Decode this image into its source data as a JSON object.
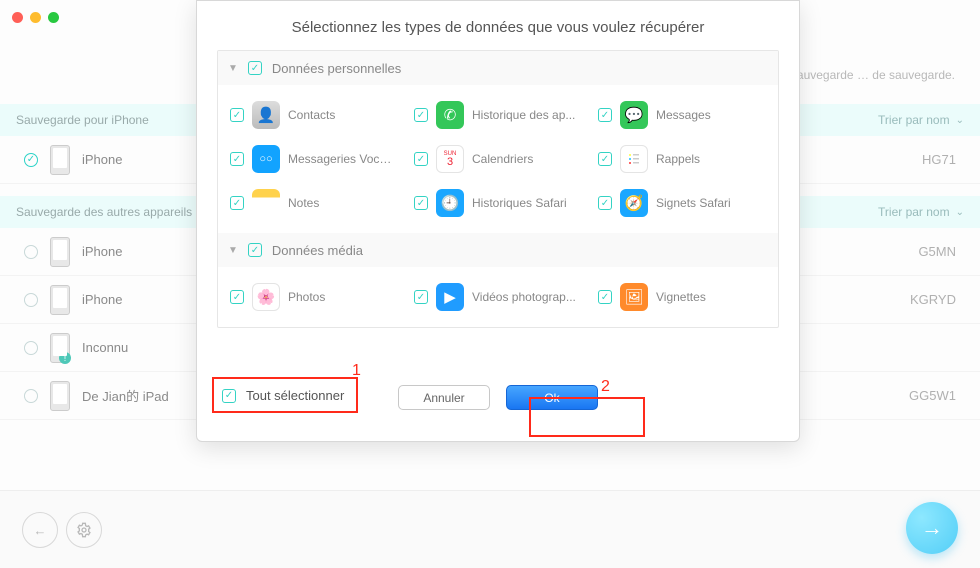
{
  "traffic": {
    "close": "close",
    "min": "minimize",
    "max": "zoom"
  },
  "hint_text": "Si votre sauvegarde … de sauvegarde.",
  "sections": {
    "iphone": {
      "title": "Sauvegarde pour iPhone",
      "sort": "Trier par nom"
    },
    "other": {
      "title": "Sauvegarde des autres appareils",
      "sort": "Trier par nom"
    }
  },
  "devices": {
    "d0": {
      "name": "iPhone",
      "code": "HG71",
      "selected": true
    },
    "d1": {
      "name": "iPhone",
      "code": "G5MN"
    },
    "d2": {
      "name": "iPhone",
      "code": "KGRYD"
    },
    "d3": {
      "name": "Inconnu",
      "code": ""
    },
    "d4": {
      "name": "De Jian的 iPad",
      "code": "GG5W1"
    }
  },
  "modal": {
    "title": "Sélectionnez les types de données que vous voulez récupérer",
    "group_personal": "Données personnelles",
    "group_media": "Données média",
    "select_all": "Tout sélectionner",
    "cancel": "Annuler",
    "ok": "Ok",
    "items": {
      "contacts": "Contacts",
      "call_history": "Historique des ap...",
      "messages": "Messages",
      "voicemail": "Messageries Vocales",
      "calendar": "Calendriers",
      "reminders": "Rappels",
      "notes": "Notes",
      "safari_history": "Historiques Safari",
      "safari_bookmarks": "Signets Safari",
      "photos": "Photos",
      "videos": "Vidéos photograp...",
      "thumbnails": "Vignettes"
    }
  },
  "annotations": {
    "n1": "1",
    "n2": "2"
  },
  "icons": {
    "colors": {
      "contacts": "#e6e6e6",
      "call": "#34c759",
      "messages": "#34c759",
      "voicemail": "#209cff",
      "calendar": "#ffffff",
      "reminders": "#ffffff",
      "notes": "#ffd24c",
      "safari_h": "#1aa7ff",
      "safari_b": "#1aa7ff",
      "photos": "#ffffff",
      "videos": "#209cff",
      "thumb": "#ff8a2b"
    }
  }
}
